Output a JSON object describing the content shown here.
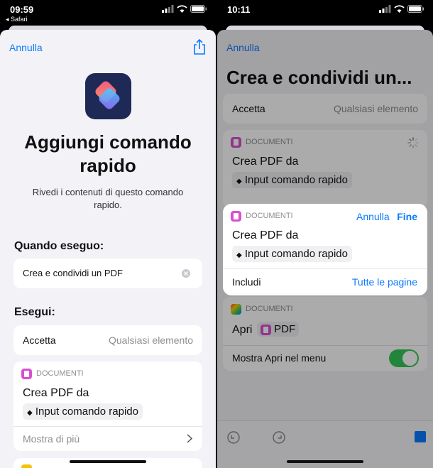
{
  "left": {
    "status": {
      "time": "09:59",
      "back_app": "◂ Safari"
    },
    "cancel_label": "Annulla",
    "title": "Aggiungi comando rapido",
    "subtitle": "Rivedi i contenuti di questo comando rapido.",
    "when_label": "Quando eseguo:",
    "when_value": "Crea e condividi un PDF",
    "run_label": "Esegui:",
    "accept_label": "Accetta",
    "accept_value": "Qualsiasi elemento",
    "action_category": "DOCUMENTI",
    "action_title": "Crea PDF da",
    "action_input": "Input comando rapido",
    "show_more": "Mostra di più"
  },
  "right": {
    "status": {
      "time": "10:11"
    },
    "cancel_label": "Annulla",
    "title": "Crea e condividi un...",
    "accept_label": "Accetta",
    "accept_value": "Qualsiasi elemento",
    "bg_category": "DOCUMENTI",
    "bg_title": "Crea PDF da",
    "bg_input": "Input comando rapido",
    "popup": {
      "category": "DOCUMENTI",
      "cancel": "Annulla",
      "done": "Fine",
      "title": "Crea PDF da",
      "input": "Input comando rapido",
      "include_label": "Includi",
      "include_value": "Tutte le pagine"
    },
    "open_category": "DOCUMENTI",
    "open_label": "Apri",
    "open_app": "PDF",
    "show_in_menu": "Mostra Apri nel menu",
    "toggle_on": true
  },
  "colors": {
    "accent": "#0a7aff",
    "documents": "#d94fd0",
    "toggle": "#34c759"
  }
}
